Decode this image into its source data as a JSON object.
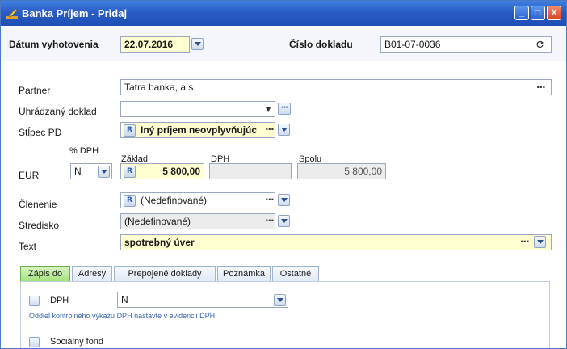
{
  "window": {
    "title": "Banka Príjem - Pridaj",
    "buttons": {
      "minimize": "_",
      "maximize": "□",
      "close": "X"
    }
  },
  "header": {
    "date_label": "Dátum vyhotovenia",
    "date_value": "22.07.2016",
    "doc_label": "Číslo dokladu",
    "doc_value": "B01-07-0036"
  },
  "form": {
    "partner_label": "Partner",
    "partner_value": "Tatra banka, a.s.",
    "paid_doc_label": "Uhrádzaný doklad",
    "paid_doc_value": "",
    "column_label": "Stĺpec PD",
    "column_value": "Iný príjem neovplyvňujúc",
    "currency_label": "EUR",
    "vat_pct_label": "% DPH",
    "vat_pct_value": "N",
    "base_label": "Základ",
    "base_value": "5 800,00",
    "vat_label": "DPH",
    "vat_value": "",
    "total_label": "Spolu",
    "total_value": "5 800,00",
    "division_label": "Členenie",
    "division_value": "(Nedefinované)",
    "center_label": "Stredisko",
    "center_value": "(Nedefinované)",
    "text_label": "Text",
    "text_value": "spotrebný úver",
    "badge": "R",
    "dots": "···"
  },
  "tabs": [
    {
      "label": "Zápis do"
    },
    {
      "label": "Adresy"
    },
    {
      "label": "Prepojené doklady"
    },
    {
      "label": "Poznámka"
    },
    {
      "label": "Ostatné"
    }
  ],
  "panel": {
    "dph_label": "DPH",
    "dph_value": "N",
    "dph_hint": "Oddiel kontrolného výkazu DPH nastavte v evidencii DPH.",
    "social_fund_label": "Sociálny fond"
  },
  "colors": {
    "title_bar": "#2a5cc4",
    "field_highlight": "#ffffd2",
    "active_tab": "#9fe07a"
  }
}
